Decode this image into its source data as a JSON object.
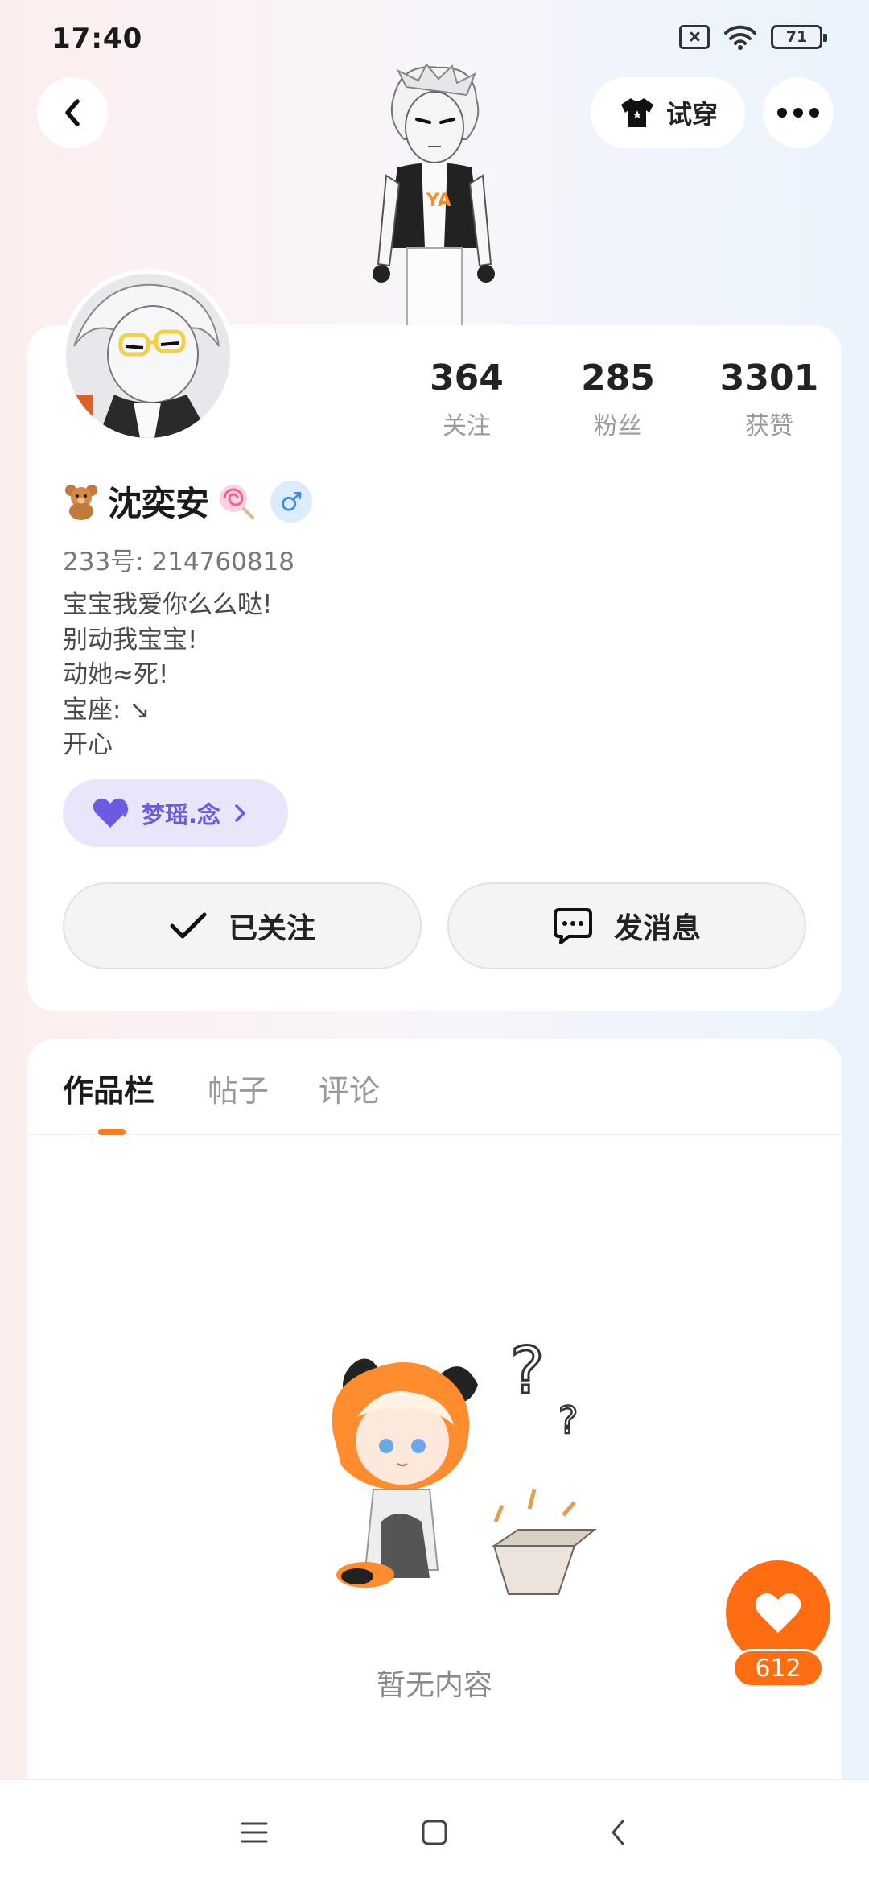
{
  "status_bar": {
    "time": "17:40",
    "battery": "71",
    "icons": [
      "sim-off-icon",
      "wifi-icon",
      "battery-icon"
    ]
  },
  "header": {
    "back_icon": "chevron-left-icon",
    "tryon_label": "试穿",
    "tryon_icon": "shirt-icon",
    "more_icon": "more-horizontal-icon"
  },
  "profile": {
    "stats": [
      {
        "value": "364",
        "label": "关注"
      },
      {
        "value": "285",
        "label": "粉丝"
      },
      {
        "value": "3301",
        "label": "获赞"
      }
    ],
    "nickname": "沈奕安",
    "nickname_prefix_icon": "teddy-bear-icon",
    "nickname_suffix_icon": "lollipop-icon",
    "gender_symbol": "♂",
    "uid": "233号: 214760818",
    "bio": [
      "宝宝我爱你么么哒!",
      "别动我宝宝!",
      "动她≈死!",
      "宝座: ↘",
      "开心"
    ],
    "guild": {
      "label": "梦瑶.念",
      "icon": "heart-icon"
    },
    "follow_label": "已关注",
    "message_label": "发消息"
  },
  "tabs": [
    {
      "label": "作品栏",
      "active": true
    },
    {
      "label": "帖子",
      "active": false
    },
    {
      "label": "评论",
      "active": false
    }
  ],
  "empty_state": {
    "text": "暂无内容"
  },
  "like_fab": {
    "count": "612"
  },
  "colors": {
    "accent": "#ff6d12",
    "guild": "#6b5be2",
    "gender": "#3a8ee6"
  },
  "nav": {
    "icons": [
      "menu-icon",
      "home-square-icon",
      "back-triangle-icon"
    ]
  }
}
